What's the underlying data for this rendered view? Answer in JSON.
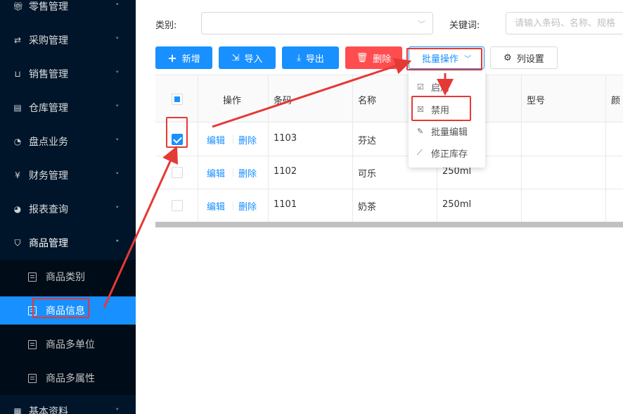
{
  "sidebar": {
    "items": [
      {
        "label": "零售管理",
        "icon": "gift-icon",
        "arrow": "˅"
      },
      {
        "label": "采购管理",
        "icon": "exchange-icon",
        "arrow": "˅"
      },
      {
        "label": "销售管理",
        "icon": "cart-icon",
        "arrow": "˅"
      },
      {
        "label": "仓库管理",
        "icon": "warehouse-icon",
        "arrow": "˅"
      },
      {
        "label": "盘点业务",
        "icon": "dashboard-icon",
        "arrow": "˅"
      },
      {
        "label": "财务管理",
        "icon": "money-icon",
        "arrow": "˅"
      },
      {
        "label": "报表查询",
        "icon": "pie-chart-icon",
        "arrow": "˅"
      },
      {
        "label": "商品管理",
        "icon": "shopping-bag-icon",
        "arrow": "˄"
      },
      {
        "label": "基本资料",
        "icon": "database-icon",
        "arrow": "˅"
      }
    ],
    "sub_items": [
      {
        "label": "商品类别"
      },
      {
        "label": "商品信息"
      },
      {
        "label": "商品多单位"
      },
      {
        "label": "商品多属性"
      }
    ]
  },
  "filters": {
    "category_label": "类别:",
    "category_value": "",
    "keyword_label": "关键词:",
    "keyword_placeholder": "请输入条码、名称、规格",
    "keyword_value": ""
  },
  "toolbar": {
    "add_label": "新增",
    "import_label": "导入",
    "export_label": "导出",
    "delete_label": "删除",
    "batch_label": "批量操作",
    "columns_label": "列设置"
  },
  "table": {
    "headers": [
      "操作",
      "条码",
      "名称",
      "型号",
      "颜"
    ],
    "rows": [
      {
        "edit": "编辑",
        "del": "删除",
        "barcode": "1103",
        "name": "芬达",
        "spec": "",
        "checked": true
      },
      {
        "edit": "编辑",
        "del": "删除",
        "barcode": "1102",
        "name": "可乐",
        "spec": "250ml",
        "checked": false
      },
      {
        "edit": "编辑",
        "del": "删除",
        "barcode": "1101",
        "name": "奶茶",
        "spec": "250ml",
        "checked": false
      }
    ]
  },
  "dropdown": {
    "items": [
      {
        "label": "启用",
        "icon": "check-square-icon"
      },
      {
        "label": "禁用",
        "icon": "close-square-icon"
      },
      {
        "label": "批量编辑",
        "icon": "edit-icon"
      },
      {
        "label": "修正库存",
        "icon": "stock-icon"
      }
    ]
  },
  "colors": {
    "sidebar_bg": "#001529",
    "primary": "#1890ff",
    "danger": "#ff4d4f",
    "annotation": "#e53935"
  }
}
